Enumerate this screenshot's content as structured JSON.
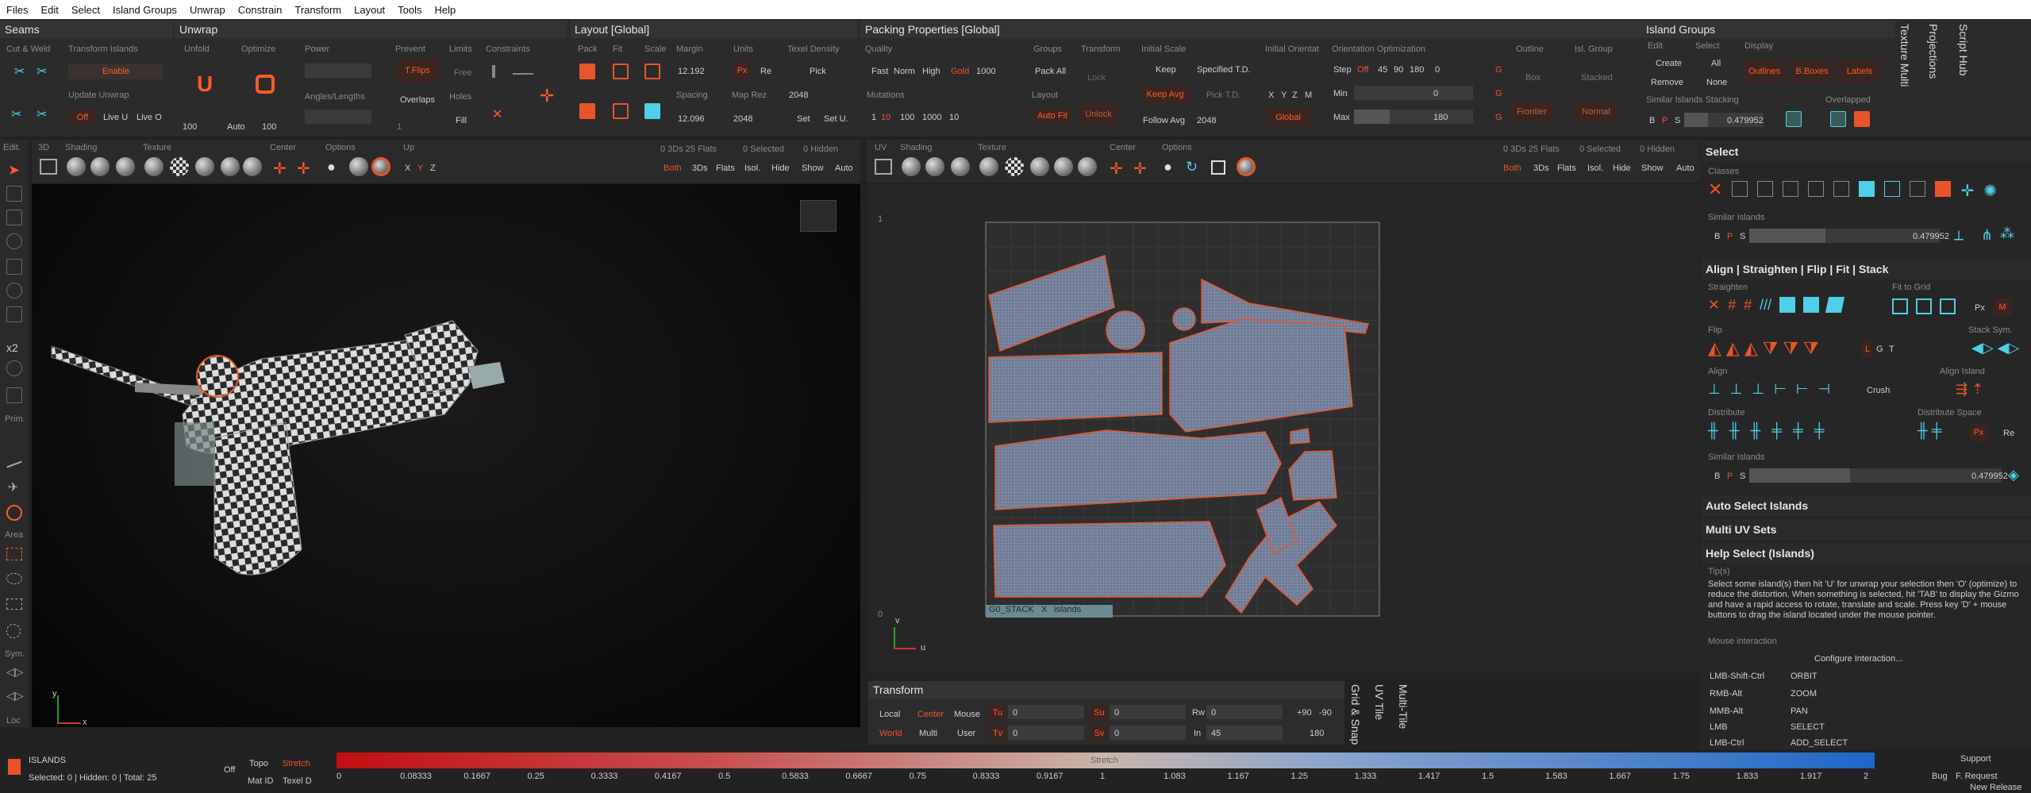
{
  "menu": [
    "Files",
    "Edit",
    "Select",
    "Island Groups",
    "Unwrap",
    "Constrain",
    "Transform",
    "Layout",
    "Tools",
    "Help"
  ],
  "seams": {
    "title": "Seams",
    "cut_weld": "Cut & Weld",
    "transform_islands": "Transform Islands",
    "enable": "Enable",
    "update_unwrap": "Update Unwrap",
    "off": "Off",
    "live_u": "Live U",
    "live_o": "Live O"
  },
  "unwrap": {
    "title": "Unwrap",
    "unfold": "Unfold",
    "optimize": "Optimize",
    "power": "Power",
    "prevent": "Prevent",
    "limits": "Limits",
    "constraints": "Constraints",
    "tflips": "T.Flips",
    "free": "Free",
    "overlaps": "Overlaps",
    "holes": "Holes",
    "angles": "Angles/Lengths",
    "v100": "100",
    "auto": "Auto",
    "v100b": "100",
    "v1": "1",
    "fill": "Fill"
  },
  "layout": {
    "title": "Layout [Global]",
    "pack": "Pack",
    "fit": "Fit",
    "scale": "Scale",
    "margin": "Margin",
    "units": "Units",
    "texel": "Texel Density",
    "margin_val": "12.192",
    "px": "Px",
    "re": "Re",
    "pick": "Pick",
    "spacing": "Spacing",
    "map_res": "Map Rez",
    "map_val": "2048",
    "spacing_val": "12.096",
    "map_val2": "2048",
    "set": "Set",
    "setu": "Set U."
  },
  "packing": {
    "title": "Packing Properties [Global]",
    "quality": "Quality",
    "fast": "Fast",
    "norm": "Norm",
    "high": "High",
    "gold": "Gold",
    "q_val": "1000",
    "groups": "Groups",
    "pack_all": "Pack All",
    "transform": "Transform",
    "lock": "Lock",
    "layout": "Layout",
    "auto_fit": "Auto Fit",
    "unlock": "Unlock",
    "mutations": "Mutations",
    "m1": "1",
    "m10": "10",
    "m100": "100",
    "m1000": "1000",
    "m_val": "10",
    "initial_scale": "Initial Scale",
    "keep": "Keep",
    "specified": "Specified T.D.",
    "keep_avg": "Keep Avg",
    "pick_td": "Pick T.D.",
    "follow_avg": "Follow Avg",
    "follow_val": "2048",
    "initial_orient": "Initial Orientat",
    "x": "X",
    "y": "Y",
    "z": "Z",
    "m": "M",
    "global": "Global",
    "orient_opt": "Orientation Optimization",
    "step": "Step",
    "off": "Off",
    "s45": "45",
    "s90": "90",
    "s180": "180",
    "step_val": "0",
    "min": "Min",
    "min_val": "0",
    "max": "Max",
    "max_val": "180",
    "g": "G",
    "outline": "Outline",
    "box": "Box",
    "frontier": "Frontier",
    "isl_group": "Isl. Group",
    "stacked": "Stacked",
    "normal": "Normal"
  },
  "island_groups": {
    "title": "Island Groups",
    "edit": "Edit",
    "select": "Select",
    "display": "Display",
    "create": "Create",
    "all": "All",
    "outlines": "Outlines",
    "bboxes": "B.Boxes",
    "labels": "Labels",
    "remove": "Remove",
    "none": "None",
    "similar": "Similar Islands Stacking",
    "overlapped": "Overlapped",
    "b": "B",
    "p": "P",
    "s": "S",
    "val": "0.479952"
  },
  "side_tabs": [
    "Texture Multi",
    "Projections",
    "Script Hub"
  ],
  "vp3d": {
    "edit": "Edit.",
    "d3": "3D",
    "shading": "Shading",
    "texture": "Texture",
    "center": "Center",
    "options": "Options",
    "up": "Up",
    "x": "X",
    "y": "Y",
    "z": "Z",
    "info1": "0 3Ds 25 Flats",
    "info2": "0 Selected",
    "info3": "0 Hidden",
    "both": "Both",
    "d3s": "3Ds",
    "flats": "Flats",
    "isol": "Isol.",
    "hide": "Hide",
    "show": "Show",
    "auto": "Auto",
    "axis_y": "y",
    "axis_x": "x"
  },
  "left_tools": [
    "x2",
    "Prim.",
    "Area",
    "Sym.",
    "Loc"
  ],
  "vpuv": {
    "uv": "UV",
    "shading": "Shading",
    "texture": "Texture",
    "center": "Center",
    "options": "Options",
    "info1": "0 3Ds 25 Flats",
    "info2": "0 Selected",
    "info3": "0 Hidden",
    "both": "Both",
    "d3s": "3Ds",
    "flats": "Flats",
    "isol": "Isol.",
    "hide": "Hide",
    "show": "Show",
    "auto": "Auto",
    "stack_tag": "G0_STACK",
    "x_tag": "X",
    "islands_tag": "islands",
    "axis_v": "v",
    "axis_u": "u",
    "tick1": "1",
    "tick0": "0"
  },
  "transform": {
    "title": "Transform",
    "local": "Local",
    "center": "Center",
    "mouse": "Mouse",
    "world": "World",
    "multi": "Multi",
    "user": "User",
    "tu": "Tu",
    "tv": "Tv",
    "su": "Su",
    "sv": "Sv",
    "rw": "Rw",
    "in": "In",
    "tu_val": "0",
    "tv_val": "0",
    "su_val": "0",
    "sv_val": "0",
    "rw_val": "0",
    "in_val": "45",
    "p90": "+90",
    "m90": "-90",
    "r180": "180"
  },
  "bottom_tabs": [
    "Grid & Snap",
    "UV Tile",
    "Multi-Tile"
  ],
  "status": {
    "islands": "ISLANDS",
    "summary": "Selected: 0 | Hidden: 0 | Total: 25",
    "off": "Off",
    "topo": "Topo",
    "stretch": "Stretch",
    "matid": "Mat ID",
    "texel": "Texel D",
    "bar_label": "Stretch",
    "ticks": [
      "0",
      "0.08333",
      "0.1667",
      "0.25",
      "0.3333",
      "0.4167",
      "0.5",
      "0.5833",
      "0.6667",
      "0.75",
      "0.8333",
      "0.9167",
      "1",
      "1.083",
      "1.167",
      "1.25",
      "1.333",
      "1.417",
      "1.5",
      "1.583",
      "1.667",
      "1.75",
      "1.833",
      "1.917",
      "2"
    ],
    "support": "Support",
    "bug": "Bug",
    "freq": "F. Request",
    "newrel": "New Release"
  },
  "right": {
    "select_title": "Select",
    "classes": "Classes",
    "similar": "Similar Islands",
    "b": "B",
    "p": "P",
    "s": "S",
    "sim_val": "0.479952",
    "align_title": "Align | Straighten | Flip | Fit | Stack",
    "straighten": "Straighten",
    "fit_grid": "Fit to Grid",
    "px": "Px",
    "m": "M",
    "flip": "Flip",
    "stack_sym": "Stack Sym.",
    "l": "L",
    "g": "G",
    "t": "T",
    "align": "Align",
    "align_island": "Align Island",
    "crush": "Crush",
    "distribute": "Distribute",
    "dist_space": "Distribute Space",
    "px2": "Px",
    "re": "Re",
    "similar2": "Similar Islands",
    "sim_val2": "0.479952",
    "auto_select": "Auto Select Islands",
    "multi_uv": "Multi UV Sets",
    "help_title": "Help Select (Islands)",
    "tips": "Tip(s)",
    "help_text": "Select some island(s) then hit 'U' for unwrap your selection then 'O' (optimize) to reduce the distortion. When something is selected, hit 'TAB' to display the Gizmo and have a rapid access to rotate, translate and scale. Press key 'D' + mouse buttons to drag the island located under the mouse pointer.",
    "mouse_inter": "Mouse interaction",
    "configure": "Configure Interaction...",
    "keys": [
      [
        "LMB-Shift-Ctrl",
        "ORBIT"
      ],
      [
        "RMB-Alt",
        "ZOOM"
      ],
      [
        "MMB-Alt",
        "PAN"
      ],
      [
        "LMB",
        "SELECT"
      ],
      [
        "LMB-Ctrl",
        "ADD_SELECT"
      ]
    ]
  },
  "colors": {
    "accent": "#e8552a",
    "cyan": "#4fd0e8",
    "uvblue": "#7e8aa8"
  }
}
